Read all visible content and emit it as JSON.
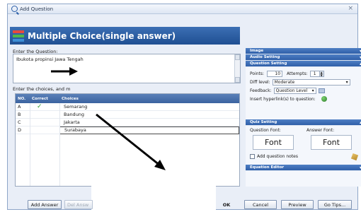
{
  "window": {
    "title": "Add Question"
  },
  "header": {
    "title": "Multiple Choice(single answer)"
  },
  "question": {
    "label": "Enter the Question:",
    "text": "Ibukota propinsi Jawa Tengah"
  },
  "choices": {
    "label": "Enter the choices, and m",
    "columns": [
      "NO.",
      "Correct",
      "Choices"
    ],
    "rows": [
      {
        "no": "A",
        "correct": "✓",
        "choice": "Semarang"
      },
      {
        "no": "B",
        "correct": "",
        "choice": "Bandung"
      },
      {
        "no": "C",
        "correct": "",
        "choice": "Jakarta"
      },
      {
        "no": "D",
        "correct": "",
        "choice": "Surabaya"
      }
    ]
  },
  "panel": {
    "image": "Image",
    "audio": "Audio Setting",
    "question_setting": "Question Setting",
    "points_label": "Points:",
    "points_value": "10",
    "attempts_label": "Attempts:",
    "attempts_value": "1",
    "diff_label": "Diff level:",
    "diff_value": "Moderate",
    "feedback_label": "Feedback:",
    "feedback_value": "Question Level",
    "hyperlink_label": "Insert hyperlink(s) to question:",
    "quiz_setting": "Quiz Setting",
    "question_font_label": "Question Font:",
    "answer_font_label": "Answer Font:",
    "question_font_button": "Font",
    "answer_font_button": "Font",
    "notes_label": "Add question notes",
    "equation_editor": "Equation Editor"
  },
  "buttons": {
    "add_answer": "Add Answer",
    "del_answer": "Del Answ",
    "ok": "OK",
    "cancel": "Cancel",
    "preview": "Preview",
    "go_tips": "Go Tips..."
  },
  "icons": {
    "window": "search-icon",
    "header": "multiple-choice-icon",
    "hyperlink": "globe-icon",
    "feedback_edit": "folder-icon",
    "notes_edit": "pencil-icon",
    "correct": "checkmark-icon",
    "annotation": "arrow-icon"
  },
  "colors": {
    "header_bg": "#2a5ea8",
    "section_header": "#3f6fb8",
    "table_header": "#4a72ac",
    "check": "#2e9c2a"
  }
}
